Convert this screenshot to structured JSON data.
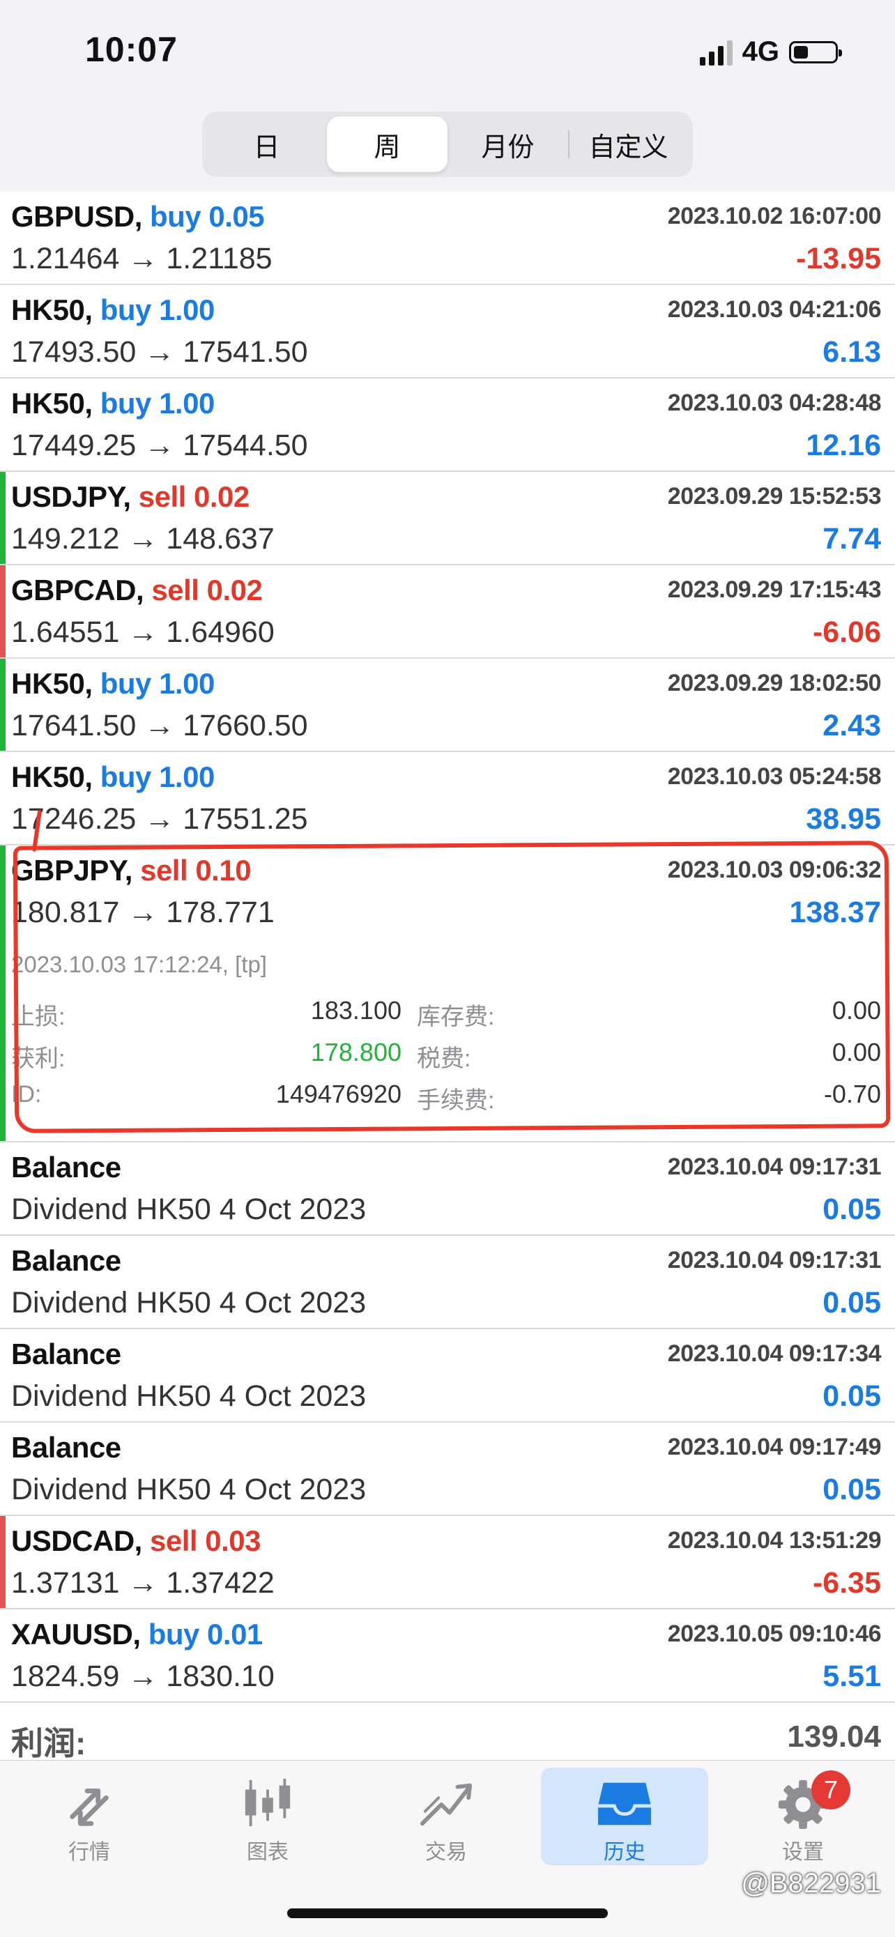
{
  "status": {
    "time": "10:07",
    "network": "4G"
  },
  "segments": [
    {
      "label": "日",
      "active": false
    },
    {
      "label": "周",
      "active": true
    },
    {
      "label": "月份",
      "active": false
    },
    {
      "label": "自定义",
      "active": false
    }
  ],
  "rows": [
    {
      "symbol": "GBPUSD,",
      "side": "buy",
      "side_text": "buy 0.05",
      "date": "2023.10.02 16:07:00",
      "price": "1.21464 → 1.21185",
      "profit": "-13.95",
      "bar": "none"
    },
    {
      "symbol": "HK50,",
      "side": "buy",
      "side_text": "buy 1.00",
      "date": "2023.10.03 04:21:06",
      "price": "17493.50 → 17541.50",
      "profit": "6.13",
      "bar": "none"
    },
    {
      "symbol": "HK50,",
      "side": "buy",
      "side_text": "buy 1.00",
      "date": "2023.10.03 04:28:48",
      "price": "17449.25 → 17544.50",
      "profit": "12.16",
      "bar": "none"
    },
    {
      "symbol": "USDJPY,",
      "side": "sell",
      "side_text": "sell 0.02",
      "date": "2023.09.29 15:52:53",
      "price": "149.212 → 148.637",
      "profit": "7.74",
      "bar": "green"
    },
    {
      "symbol": "GBPCAD,",
      "side": "sell",
      "side_text": "sell 0.02",
      "date": "2023.09.29 17:15:43",
      "price": "1.64551 → 1.64960",
      "profit": "-6.06",
      "bar": "red"
    },
    {
      "symbol": "HK50,",
      "side": "buy",
      "side_text": "buy 1.00",
      "date": "2023.09.29 18:02:50",
      "price": "17641.50 → 17660.50",
      "profit": "2.43",
      "bar": "green"
    },
    {
      "symbol": "HK50,",
      "side": "buy",
      "side_text": "buy 1.00",
      "date": "2023.10.03 05:24:58",
      "price": "17246.25 → 17551.25",
      "profit": "38.95",
      "bar": "none"
    },
    {
      "symbol": "GBPJPY,",
      "side": "sell",
      "side_text": "sell 0.10",
      "date": "2023.10.03 09:06:32",
      "price": "180.817 → 178.771",
      "profit": "138.37",
      "bar": "green",
      "expanded": true
    },
    {
      "symbol": "Balance",
      "side": "",
      "side_text": "",
      "date": "2023.10.04 09:17:31",
      "price": "Dividend HK50 4 Oct 2023",
      "profit": "0.05",
      "bar": "none"
    },
    {
      "symbol": "Balance",
      "side": "",
      "side_text": "",
      "date": "2023.10.04 09:17:31",
      "price": "Dividend HK50 4 Oct 2023",
      "profit": "0.05",
      "bar": "none"
    },
    {
      "symbol": "Balance",
      "side": "",
      "side_text": "",
      "date": "2023.10.04 09:17:34",
      "price": "Dividend HK50 4 Oct 2023",
      "profit": "0.05",
      "bar": "none"
    },
    {
      "symbol": "Balance",
      "side": "",
      "side_text": "",
      "date": "2023.10.04 09:17:49",
      "price": "Dividend HK50 4 Oct 2023",
      "profit": "0.05",
      "bar": "none"
    },
    {
      "symbol": "USDCAD,",
      "side": "sell",
      "side_text": "sell 0.03",
      "date": "2023.10.04 13:51:29",
      "price": "1.37131 → 1.37422",
      "profit": "-6.35",
      "bar": "red"
    },
    {
      "symbol": "XAUUSD,",
      "side": "buy",
      "side_text": "buy 0.01",
      "date": "2023.10.05 09:10:46",
      "price": "1824.59 → 1830.10",
      "profit": "5.51",
      "bar": "none"
    }
  ],
  "detail": {
    "close_time": "2023.10.03 17:12:24, [tp]",
    "sl_label": "止损:",
    "sl_value": "183.100",
    "tp_label": "获利:",
    "tp_value": "178.800",
    "id_label": "ID:",
    "id_value": "149476920",
    "swap_label": "库存费:",
    "swap_value": "0.00",
    "tax_label": "税费:",
    "tax_value": "0.00",
    "fee_label": "手续费:",
    "fee_value": "-0.70"
  },
  "total": {
    "label": "利润:",
    "value": "139.04"
  },
  "tabs": [
    {
      "label": "行情",
      "icon": "quotes-arrows-icon",
      "active": false
    },
    {
      "label": "图表",
      "icon": "candlestick-chart-icon",
      "active": false
    },
    {
      "label": "交易",
      "icon": "trade-trend-icon",
      "active": false
    },
    {
      "label": "历史",
      "icon": "history-inbox-icon",
      "active": true
    },
    {
      "label": "设置",
      "icon": "gear-icon",
      "active": false,
      "badge": "7"
    }
  ],
  "watermark": "@B822931",
  "colors": {
    "buy": "#1a7be0",
    "sell": "#e0392b",
    "green_bar": "#1fb33a",
    "red_bar": "#e05454",
    "highlight": "#e8382a",
    "active_tab": "#d3e6fb"
  }
}
